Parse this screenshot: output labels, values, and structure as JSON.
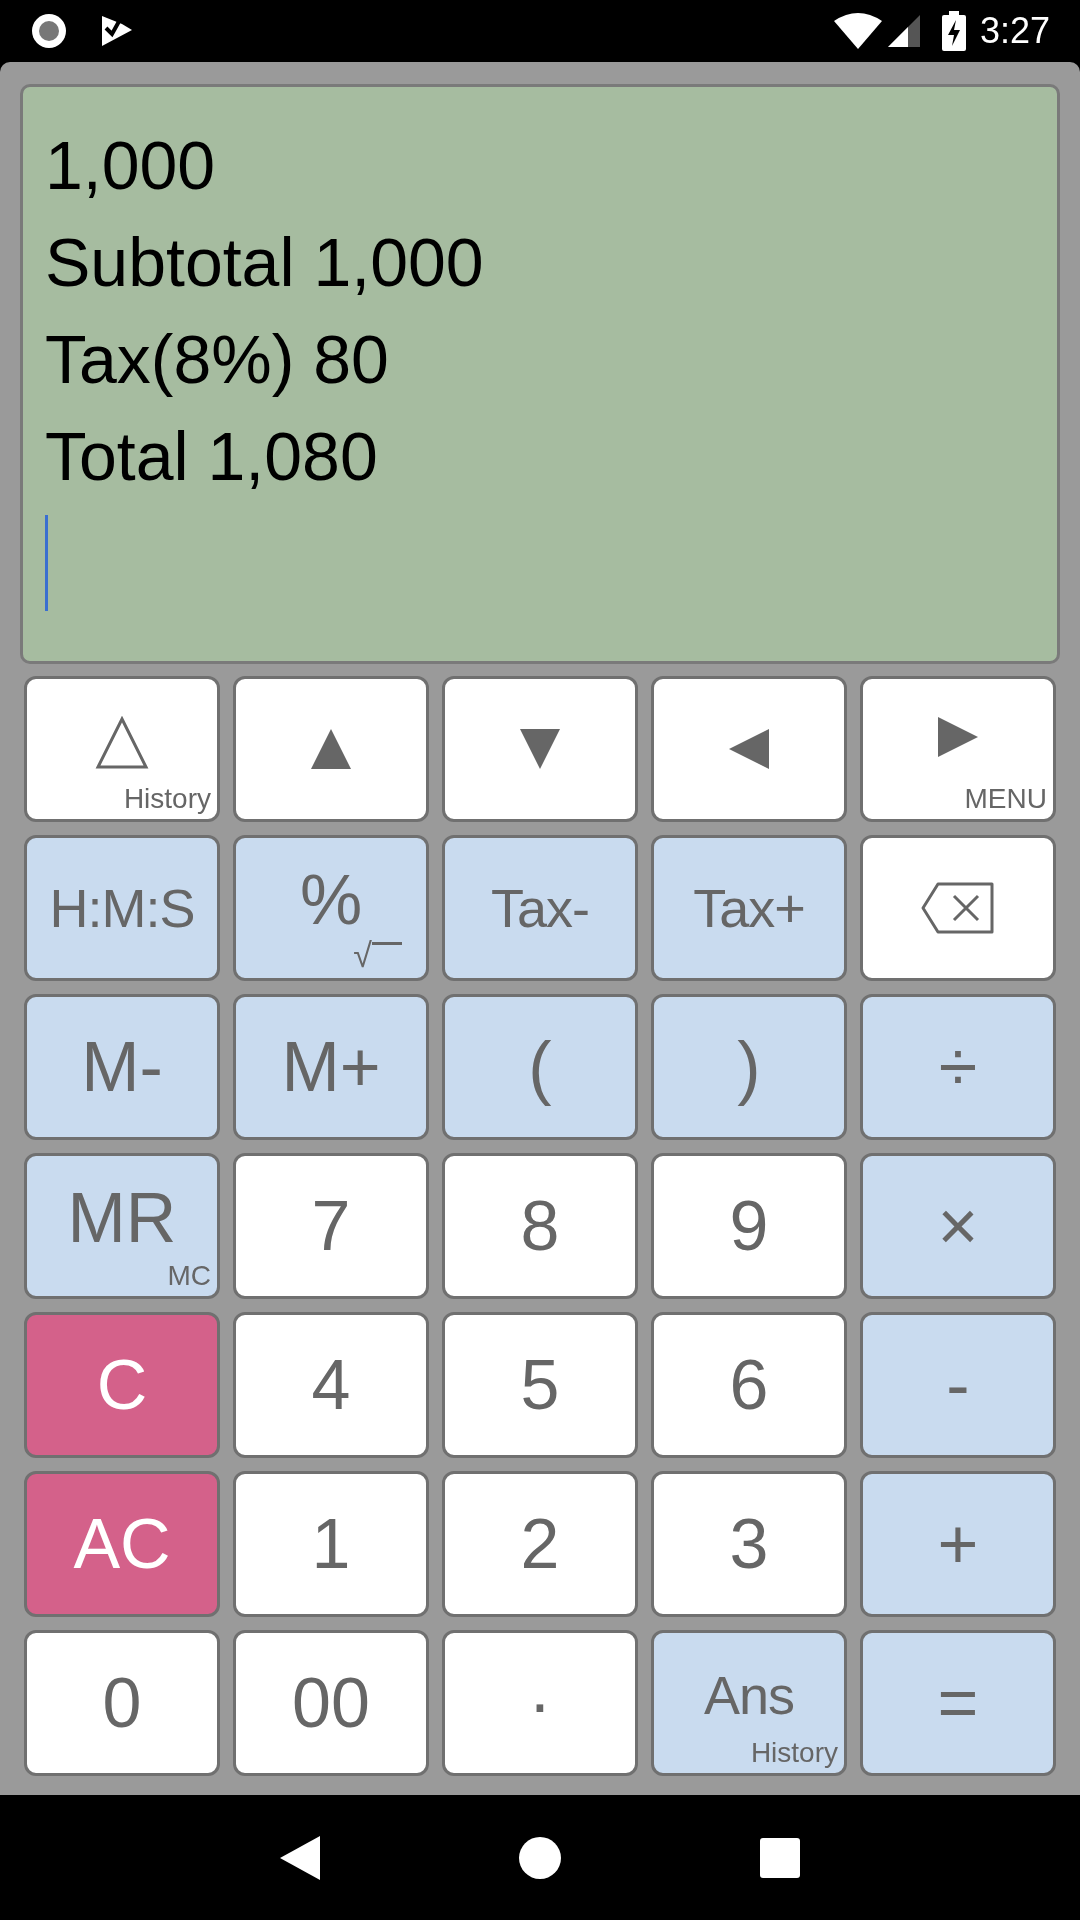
{
  "status_bar": {
    "time": "3:27"
  },
  "display": {
    "lines": [
      "1,000",
      "Subtotal 1,000",
      "Tax(8%) 80",
      "Total 1,080"
    ],
    "cursor": true
  },
  "keys": [
    {
      "kind": "history",
      "color": "#ffffff",
      "sub": "History"
    },
    {
      "kind": "up",
      "color": "#ffffff"
    },
    {
      "kind": "down",
      "color": "#ffffff"
    },
    {
      "kind": "left",
      "color": "#ffffff"
    },
    {
      "kind": "right",
      "color": "#ffffff",
      "sub": "MENU"
    },
    {
      "kind": "text",
      "color": "#c9dbef",
      "label": "H:M:S"
    },
    {
      "kind": "root",
      "color": "#c9dbef",
      "label": "%",
      "sub": "√"
    },
    {
      "kind": "text",
      "color": "#c9dbef",
      "label": "Tax-"
    },
    {
      "kind": "text",
      "color": "#c9dbef",
      "label": "Tax+"
    },
    {
      "kind": "backspace",
      "color": "#ffffff"
    },
    {
      "kind": "text",
      "color": "#c9dbef",
      "label": "M-"
    },
    {
      "kind": "text",
      "color": "#c9dbef",
      "label": "M+"
    },
    {
      "kind": "text",
      "color": "#c9dbef",
      "label": "("
    },
    {
      "kind": "text",
      "color": "#c9dbef",
      "label": ")"
    },
    {
      "kind": "text",
      "color": "#c9dbef",
      "label": "÷"
    },
    {
      "kind": "text",
      "color": "#c9dbef",
      "label": "MR",
      "sub": "MC"
    },
    {
      "kind": "text",
      "color": "#ffffff",
      "label": "7"
    },
    {
      "kind": "text",
      "color": "#ffffff",
      "label": "8"
    },
    {
      "kind": "text",
      "color": "#ffffff",
      "label": "9"
    },
    {
      "kind": "text",
      "color": "#c9dbef",
      "label": "×"
    },
    {
      "kind": "text",
      "color": "#d4618a",
      "label": "C"
    },
    {
      "kind": "text",
      "color": "#ffffff",
      "label": "4"
    },
    {
      "kind": "text",
      "color": "#ffffff",
      "label": "5"
    },
    {
      "kind": "text",
      "color": "#ffffff",
      "label": "6"
    },
    {
      "kind": "text",
      "color": "#c9dbef",
      "label": "-"
    },
    {
      "kind": "text",
      "color": "#d4618a",
      "label": "AC"
    },
    {
      "kind": "text",
      "color": "#ffffff",
      "label": "1"
    },
    {
      "kind": "text",
      "color": "#ffffff",
      "label": "2"
    },
    {
      "kind": "text",
      "color": "#ffffff",
      "label": "3"
    },
    {
      "kind": "text",
      "color": "#c9dbef",
      "label": "+"
    },
    {
      "kind": "text",
      "color": "#ffffff",
      "label": "0"
    },
    {
      "kind": "text",
      "color": "#ffffff",
      "label": "00"
    },
    {
      "kind": "text",
      "color": "#ffffff",
      "label": "·"
    },
    {
      "kind": "text",
      "color": "#c9dbef",
      "label": "Ans",
      "sub": "History"
    },
    {
      "kind": "text",
      "color": "#c9dbef",
      "label": "="
    }
  ]
}
